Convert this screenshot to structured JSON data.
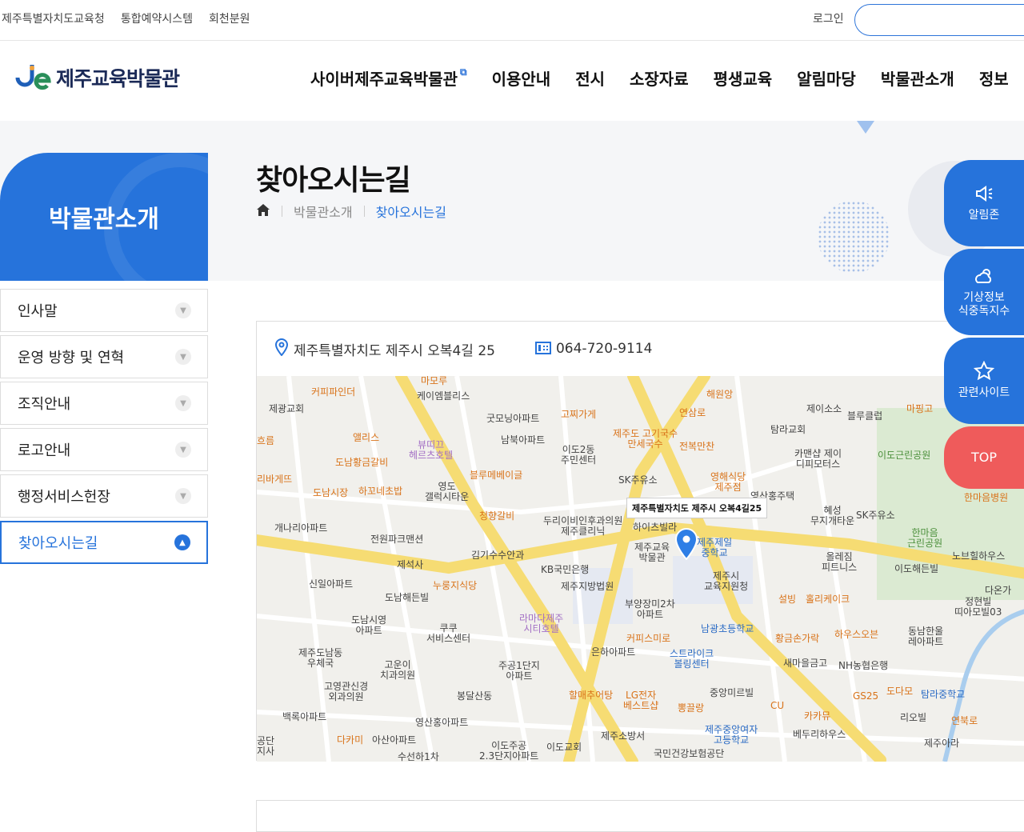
{
  "topbar": {
    "links": [
      "제주특별자치도교육청",
      "통합예약시스템",
      "회천분원"
    ],
    "login": "로그인"
  },
  "header": {
    "logo_text": "제주교육박물관",
    "gnb": [
      "사이버제주교육박물관",
      "이용안내",
      "전시",
      "소장자료",
      "평생교육",
      "알림마당",
      "박물관소개",
      "정보"
    ]
  },
  "side": {
    "title": "박물관소개",
    "menu": [
      "인사말",
      "운영 방향 및 연혁",
      "조직안내",
      "로고안내",
      "행정서비스헌장",
      "찾아오시는길"
    ]
  },
  "page": {
    "title": "찾아오시는길",
    "breadcrumb": [
      "박물관소개",
      "찾아오시는길"
    ]
  },
  "location": {
    "address": "제주특별자치도 제주시 오복4길 25",
    "tel": "064-720-9114",
    "map_tag": "제주특별자치도 제주시 오복4길25",
    "map_labels": [
      {
        "t": "마모루",
        "c": "o"
      },
      {
        "t": "커피파인더",
        "c": "o"
      },
      {
        "t": "케이엠블리스",
        "c": ""
      },
      {
        "t": "제광교회",
        "c": ""
      },
      {
        "t": "흐름",
        "c": "o"
      },
      {
        "t": "앨리스",
        "c": "o"
      },
      {
        "t": "뷰띠끄\n헤르츠호텔",
        "c": "p"
      },
      {
        "t": "굿모닝아파트",
        "c": ""
      },
      {
        "t": "고찌가게",
        "c": "o"
      },
      {
        "t": "남북아파트",
        "c": ""
      },
      {
        "t": "이도2동\n주민센터",
        "c": ""
      },
      {
        "t": "제주도 고기국수\n만세국수",
        "c": "o"
      },
      {
        "t": "전복만찬",
        "c": "o"
      },
      {
        "t": "해원앙",
        "c": "o"
      },
      {
        "t": "연삼로",
        "c": "o"
      },
      {
        "t": "탐라교회",
        "c": ""
      },
      {
        "t": "제이소소",
        "c": ""
      },
      {
        "t": "블루클럽",
        "c": ""
      },
      {
        "t": "마핑고",
        "c": "o"
      },
      {
        "t": "카맨샵 제이\n디피모터스",
        "c": ""
      },
      {
        "t": "이도근린공원",
        "c": "g"
      },
      {
        "t": "도남황금갈비",
        "c": "o"
      },
      {
        "t": "리바게뜨",
        "c": "o"
      },
      {
        "t": "도남시장",
        "c": "o"
      },
      {
        "t": "하꼬네초밥",
        "c": "o"
      },
      {
        "t": "영도\n갤럭시타운",
        "c": ""
      },
      {
        "t": "블루메베이글",
        "c": "o"
      },
      {
        "t": "SK주유소",
        "c": ""
      },
      {
        "t": "영해식당\n제주점",
        "c": "o"
      },
      {
        "t": "영산홍주택",
        "c": ""
      },
      {
        "t": "한마음병원",
        "c": "o"
      },
      {
        "t": "청향갈비",
        "c": "o"
      },
      {
        "t": "두리이비인후과의원\n제주클리닉",
        "c": ""
      },
      {
        "t": "하이츠빌라",
        "c": ""
      },
      {
        "t": "혜성\n무지개타운",
        "c": ""
      },
      {
        "t": "SK주유소",
        "c": ""
      },
      {
        "t": "개나리아파트",
        "c": ""
      },
      {
        "t": "전원파크맨션",
        "c": ""
      },
      {
        "t": "제주교육\n박물관",
        "c": ""
      },
      {
        "t": "제주제일\n중학교",
        "c": "b"
      },
      {
        "t": "한마음\n근린공원",
        "c": "g"
      },
      {
        "t": "김기수수안과",
        "c": ""
      },
      {
        "t": "KB국민은행",
        "c": ""
      },
      {
        "t": "올레짐\n피트니스",
        "c": ""
      },
      {
        "t": "노브힐하우스",
        "c": ""
      },
      {
        "t": "이도해든빌",
        "c": ""
      },
      {
        "t": "제석사",
        "c": ""
      },
      {
        "t": "신일아파트",
        "c": ""
      },
      {
        "t": "누룽지식당",
        "c": "o"
      },
      {
        "t": "제주지방법원",
        "c": ""
      },
      {
        "t": "제주시\n교육지원청",
        "c": ""
      },
      {
        "t": "도남해든빌",
        "c": ""
      },
      {
        "t": "부양장미2차\n아파트",
        "c": ""
      },
      {
        "t": "설빙",
        "c": "o"
      },
      {
        "t": "홀리케이크",
        "c": "o"
      },
      {
        "t": "다온가",
        "c": ""
      },
      {
        "t": "정현빌\n띠아모빌03",
        "c": ""
      },
      {
        "t": "도남시영\n아파트",
        "c": ""
      },
      {
        "t": "라마다제주\n시티호텔",
        "c": "p"
      },
      {
        "t": "남광초등학교",
        "c": "b"
      },
      {
        "t": "쿠쿠\n서비스센터",
        "c": ""
      },
      {
        "t": "황금손가락",
        "c": "o"
      },
      {
        "t": "하우스오븐",
        "c": "o"
      },
      {
        "t": "동남한울\n레아파트",
        "c": ""
      },
      {
        "t": "커피스미로",
        "c": "o"
      },
      {
        "t": "제주도남동\n우체국",
        "c": ""
      },
      {
        "t": "은하아파트",
        "c": ""
      },
      {
        "t": "스트라이크\n볼링센터",
        "c": "b"
      },
      {
        "t": "새마을금고",
        "c": ""
      },
      {
        "t": "NH농협은행",
        "c": ""
      },
      {
        "t": "고운이\n치과의원",
        "c": ""
      },
      {
        "t": "주공1단지\n아파트",
        "c": ""
      },
      {
        "t": "고영관신경\n외과의원",
        "c": ""
      },
      {
        "t": "할매추어탕",
        "c": "o"
      },
      {
        "t": "LG전자\n베스트샵",
        "c": "o"
      },
      {
        "t": "중앙미르빌",
        "c": ""
      },
      {
        "t": "GS25",
        "c": "o"
      },
      {
        "t": "도다모",
        "c": "o"
      },
      {
        "t": "탐라중학교",
        "c": "b"
      },
      {
        "t": "봉달산동",
        "c": ""
      },
      {
        "t": "뽕끌랑",
        "c": "o"
      },
      {
        "t": "CU",
        "c": "o"
      },
      {
        "t": "카카뮤",
        "c": "o"
      },
      {
        "t": "리오빌",
        "c": ""
      },
      {
        "t": "백록아파트",
        "c": ""
      },
      {
        "t": "영산홍아파트",
        "c": ""
      },
      {
        "t": "제주중앙여자\n고등학교",
        "c": "b"
      },
      {
        "t": "연북로",
        "c": "o"
      },
      {
        "t": "다카미",
        "c": "o"
      },
      {
        "t": "아산아파트",
        "c": ""
      },
      {
        "t": "이도주공\n2.3단지아파트",
        "c": ""
      },
      {
        "t": "이도교회",
        "c": ""
      },
      {
        "t": "제주소방서",
        "c": ""
      },
      {
        "t": "베두리하우스",
        "c": ""
      },
      {
        "t": "제주아라",
        "c": ""
      },
      {
        "t": "국민건강보험공단",
        "c": ""
      },
      {
        "t": "수선하1차",
        "c": ""
      },
      {
        "t": "공단\n지사",
        "c": ""
      }
    ]
  },
  "quick": {
    "items": [
      "알림존",
      "기상정보\n식중독지수",
      "관련사이트"
    ],
    "top": "TOP"
  },
  "colors": {
    "primary": "#2673db",
    "top_button": "#ef5b5b",
    "brand_navy": "#1b2a57"
  }
}
